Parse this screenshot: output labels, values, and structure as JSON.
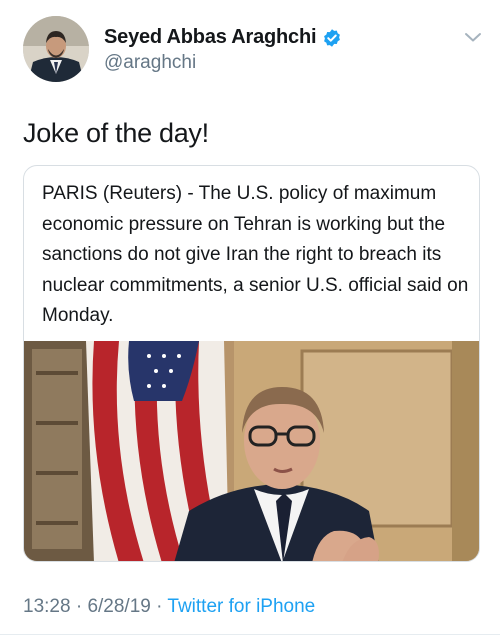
{
  "tweet": {
    "author": {
      "display_name": "Seyed Abbas Araghchi",
      "handle": "@araghchi",
      "verified": true
    },
    "text": "Joke of the day!",
    "card": {
      "quote": "PARIS (Reuters) - The U.S. policy of maximum economic pressure on Tehran is working but the sanctions do not give Iran the right to breach its nuclear commitments, a senior U.S. official said on Monday."
    },
    "footer": {
      "time": "13:28",
      "separator": "·",
      "date": "6/28/19",
      "source": "Twitter for iPhone"
    }
  },
  "icons": {
    "verified": "verified-badge-icon",
    "menu": "chevron-down-icon"
  },
  "colors": {
    "link": "#1da1f2",
    "secondary_text": "#657786",
    "primary_text": "#14171a",
    "verified": "#1da1f2"
  }
}
